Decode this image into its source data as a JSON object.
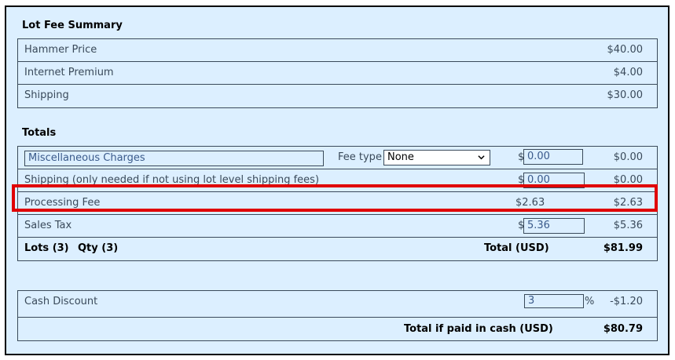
{
  "lot_fee_summary": {
    "title": "Lot Fee Summary",
    "rows": [
      {
        "label": "Hammer Price",
        "amount": "$40.00"
      },
      {
        "label": "Internet Premium",
        "amount": "$4.00"
      },
      {
        "label": "Shipping",
        "amount": "$30.00"
      }
    ]
  },
  "totals": {
    "title": "Totals",
    "misc": {
      "value": "Miscellaneous Charges",
      "fee_type_label": "Fee type",
      "fee_type_value": "None",
      "dollar": "$",
      "input": "0.00",
      "amount": "$0.00"
    },
    "shipping": {
      "label": "Shipping (only needed if not using lot level shipping fees)",
      "dollar": "$",
      "input": "0.00",
      "amount": "$0.00"
    },
    "processing": {
      "label": "Processing Fee",
      "mid": "$2.63",
      "amount": "$2.63"
    },
    "sales_tax": {
      "label": "Sales Tax",
      "dollar": "$",
      "input": "5.36",
      "amount": "$5.36"
    },
    "summary": {
      "lots": "Lots (3)",
      "qty": "Qty (3)",
      "total_label": "Total (USD)",
      "total": "$81.99"
    }
  },
  "cash": {
    "label": "Cash Discount",
    "input": "3",
    "percent": "%",
    "amount": "-$1.20",
    "total_label": "Total if paid in cash (USD)",
    "total": "$80.79"
  },
  "colors": {
    "background": "#dcefff",
    "highlight": "#e00000"
  },
  "icons": [
    "chevron-down-icon"
  ]
}
